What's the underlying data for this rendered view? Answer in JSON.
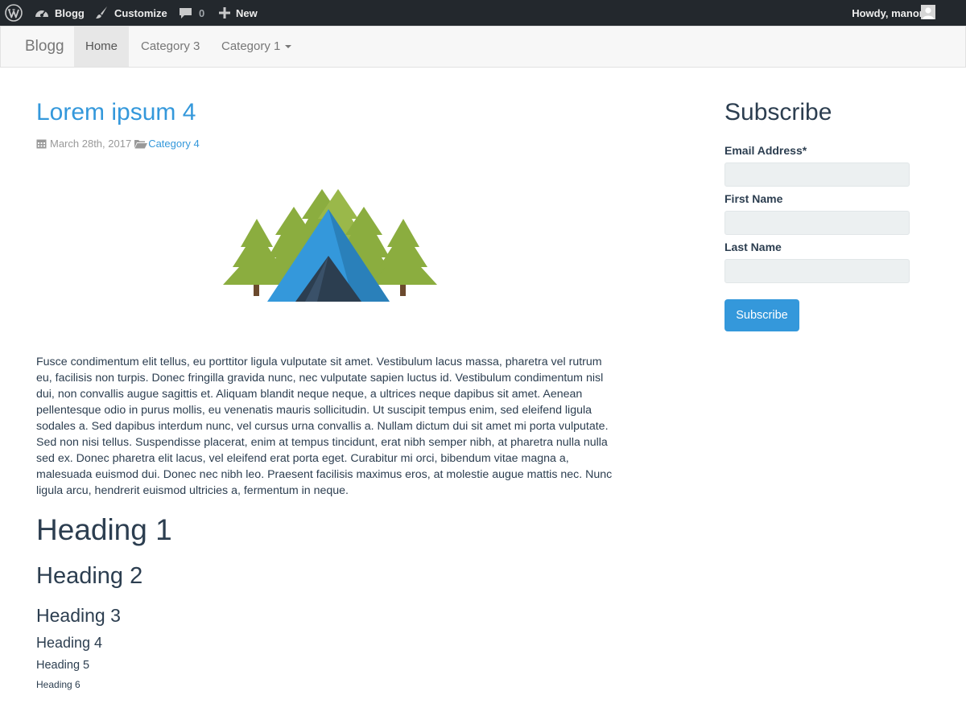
{
  "adminbar": {
    "site_name": "Blogg",
    "customize_label": "Customize",
    "comments_count": "0",
    "new_label": "New",
    "greeting": "Howdy, manornk"
  },
  "navbar": {
    "brand": "Blogg",
    "items": [
      {
        "label": "Home",
        "active": true
      },
      {
        "label": "Category 3"
      },
      {
        "label": "Category 1",
        "dropdown": true
      }
    ]
  },
  "post": {
    "title": "Lorem ipsum 4",
    "date": "March 28th, 2017",
    "category": "Category 4",
    "body": "Fusce condimentum elit tellus, eu porttitor ligula vulputate sit amet. Vestibulum lacus massa, pharetra vel rutrum eu, facilisis non turpis. Donec fringilla gravida nunc, nec vulputate sapien luctus id. Vestibulum condimentum nisl dui, non convallis augue sagittis et. Aliquam blandit neque neque, a ultrices neque dapibus sit amet. Aenean pellentesque odio in purus mollis, eu venenatis mauris sollicitudin. Ut suscipit tempus enim, sed eleifend ligula sodales a. Sed dapibus interdum nunc, vel cursus urna convallis a. Nullam dictum dui sit amet mi porta vulputate. Sed non nisi tellus. Suspendisse placerat, enim at tempus tincidunt, erat nibh semper nibh, at pharetra nulla nulla sed ex. Donec pharetra elit lacus, vel eleifend erat porta eget. Curabitur mi orci, bibendum vitae magna a, malesuada euismod dui. Donec nec nibh leo. Praesent facilisis maximus eros, at molestie augue mattis nec. Nunc ligula arcu, hendrerit euismod ultricies a, fermentum in neque.",
    "headings": [
      "Heading 1",
      "Heading 2",
      "Heading 3",
      "Heading 4",
      "Heading 5",
      "Heading 6"
    ]
  },
  "sidebar": {
    "title": "Subscribe",
    "email_label": "Email Address*",
    "email_value": "",
    "first_name_label": "First Name",
    "first_name_value": "",
    "last_name_label": "Last Name",
    "last_name_value": "",
    "submit_label": "Subscribe"
  },
  "icons": {
    "wp_logo": "wordpress-icon",
    "dashboard": "dashboard-icon",
    "customize": "paintbrush-icon",
    "comments": "comment-icon",
    "new": "plus-icon",
    "avatar": "avatar-icon",
    "date": "calendar-icon",
    "category": "folder-open-icon"
  },
  "colors": {
    "admin_bar_bg": "#23282d",
    "accent": "#3498db",
    "text": "#2c3e50",
    "navbar_bg": "#f7f7f7",
    "tree_green": "#8bad3f",
    "tent_blue": "#3498db",
    "tent_dark": "#2c3e50"
  }
}
